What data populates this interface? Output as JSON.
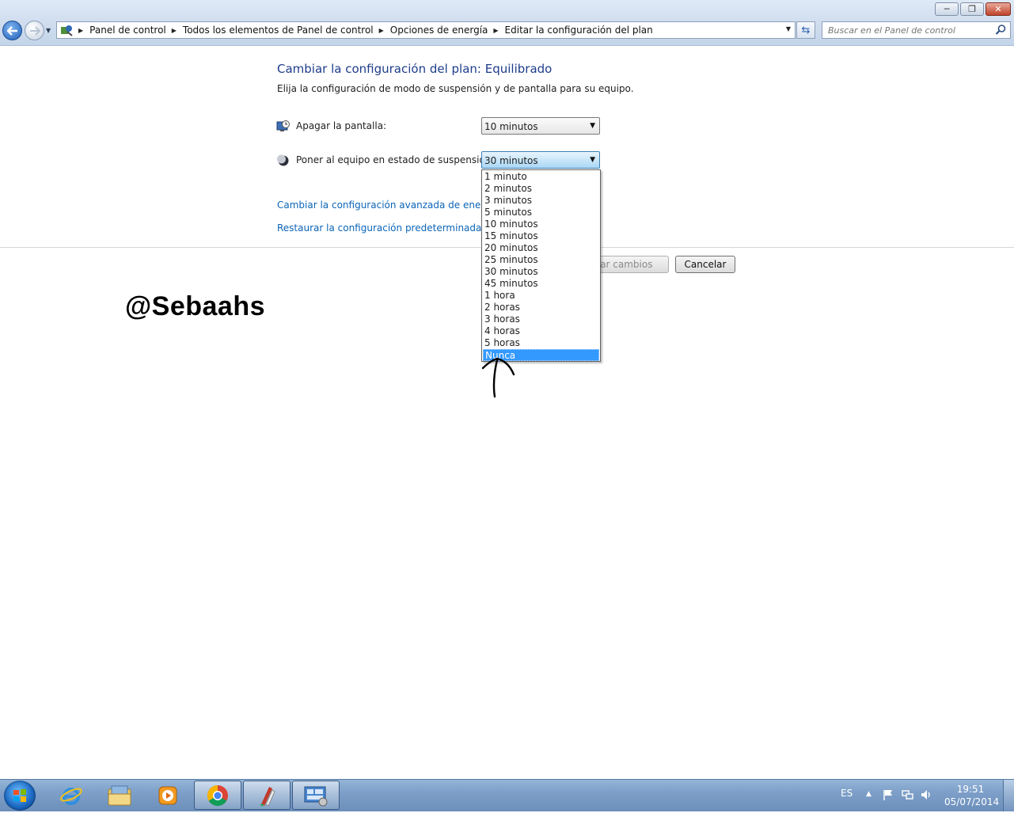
{
  "window": {
    "minimize_icon": "minimize-icon",
    "restore_icon": "restore-icon",
    "close_icon": "close-icon"
  },
  "address_bar": {
    "icon": "control-panel-icon",
    "breadcrumbs": [
      "Panel de control",
      "Todos los elementos de Panel de control",
      "Opciones de energía",
      "Editar la configuración del plan"
    ]
  },
  "search": {
    "placeholder": "Buscar en el Panel de control",
    "icon": "search-icon"
  },
  "main": {
    "title": "Cambiar la configuración del plan: Equilibrado",
    "subtitle": "Elija la configuración de modo de suspensión y de pantalla para su equipo.",
    "display": {
      "label": "Apagar la pantalla:",
      "value": "10 minutos",
      "icon": "monitor-clock-icon"
    },
    "sleep": {
      "label": "Poner al equipo en estado de suspensión:",
      "value": "30 minutos",
      "icon": "moon-icon"
    },
    "links": {
      "advanced": "Cambiar la configuración avanzada de energía",
      "restore": "Restaurar la configuración predeterminada de est"
    },
    "buttons": {
      "save": "ardar cambios",
      "cancel": "Cancelar"
    }
  },
  "dropdown": {
    "options": [
      "1 minuto",
      "2 minutos",
      "3 minutos",
      "5 minutos",
      "10 minutos",
      "15 minutos",
      "20 minutos",
      "25 minutos",
      "30 minutos",
      "45 minutos",
      "1 hora",
      "2 horas",
      "3 horas",
      "4 horas",
      "5 horas",
      "Nunca"
    ],
    "highlighted": "Nunca",
    "highlight_color": "#3399ff"
  },
  "watermark": "@Sebaahs",
  "taskbar": {
    "pinned": [
      "ie-icon",
      "explorer-folder-icon",
      "media-player-icon",
      "chrome-icon",
      "paint-brush-icon",
      "control-panel-window-icon"
    ],
    "language": "ES",
    "clock_time": "19:51",
    "clock_date": "05/07/2014"
  },
  "colors": {
    "link": "#0b64b8",
    "title": "#1e3d8a",
    "taskbar": "#7d9fc8"
  }
}
